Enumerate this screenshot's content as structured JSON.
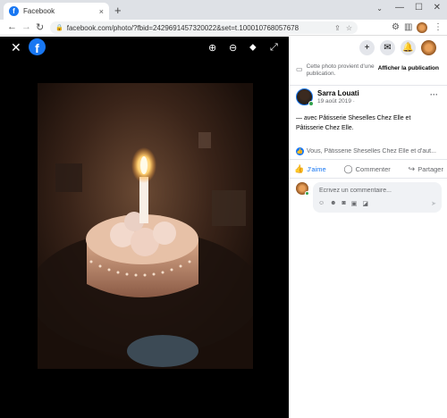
{
  "browser": {
    "tab_title": "Facebook",
    "tab_close": "×",
    "new_tab": "+",
    "url": "facebook.com/photo/?fbid=2429691457320022&set=t.100010768057678",
    "window_min": "—",
    "window_max": "☐",
    "window_close": "✕",
    "chevron": "⌄"
  },
  "viewer": {
    "logo": "f"
  },
  "panel": {
    "notice_text": "Cette photo provient d'une publication.",
    "notice_button": "Afficher la publication",
    "author_name": "Sarra Louati",
    "post_date": "19 août 2019 ·",
    "caption": "— avec Pâtisserie Sheselles Chez Elle et Pâtisserie Chez Elle.",
    "tagged": "Vous, Pâtisserie Sheselles Chez Elle et d'aut...",
    "actions": {
      "like": "J'aime",
      "comment": "Commenter",
      "share": "Partager"
    },
    "comment_placeholder": "Écrivez un commentaire..."
  },
  "icons": {
    "close": "close-icon",
    "zoom_in": "zoom-in-icon",
    "zoom_out": "zoom-out-icon",
    "tag": "tag-icon",
    "fullscreen": "fullscreen-icon",
    "plus": "plus-icon",
    "messenger": "messenger-icon",
    "notifications": "bell-icon"
  },
  "colors": {
    "brand": "#1877f2",
    "viewer_bg": "#000000",
    "online": "#31a24c"
  }
}
